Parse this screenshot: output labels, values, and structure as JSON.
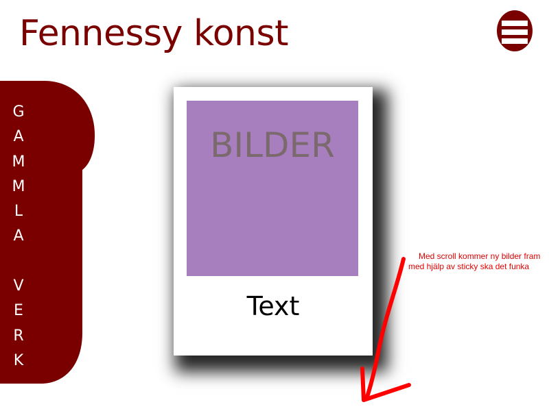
{
  "header": {
    "title": "Fennessy konst",
    "menu_icon": "hamburger-icon",
    "accent_color": "#7a0000"
  },
  "side_nav": {
    "letters": [
      "G",
      "A",
      "M",
      "M",
      "L",
      "A",
      " ",
      "V",
      "E",
      "R",
      "K"
    ],
    "color": "#7a0000"
  },
  "card": {
    "image_label": "BILDER",
    "caption": "Text",
    "image_color": "#a87fbe"
  },
  "annotation": {
    "line1": "Med scroll kommer ny bilder fram",
    "line2": "med hjälp av sticky ska det funka",
    "arrow_icon": "arrow-down-left-icon",
    "color": "#e00000"
  }
}
